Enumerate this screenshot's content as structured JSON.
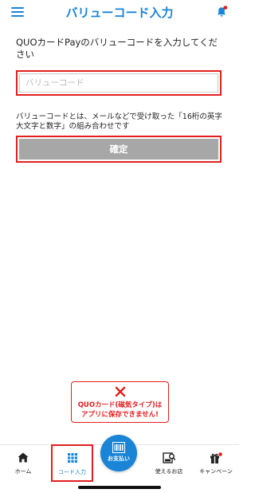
{
  "header": {
    "title": "バリューコード入力",
    "menu_icon": "hamburger-menu-icon",
    "notification_icon": "bell-icon",
    "accent_color": "#1a84d6",
    "badge_color": "#e0201d"
  },
  "main": {
    "instruction": "QUOカードPayのバリューコードを入力してください",
    "code_input": {
      "placeholder": "バリューコード",
      "value": ""
    },
    "hint": "バリューコードとは、メールなどで受け取った「16桁の英字大文字と数字」の組み合わせです",
    "confirm_label": "確定"
  },
  "warning": {
    "icon": "close-icon",
    "line1": "QUOカード(磁気タイプ)は",
    "line2": "アプリに保存できません!"
  },
  "bottom_nav": {
    "items": [
      {
        "label": "ホーム",
        "icon": "home-icon"
      },
      {
        "label": "コード入力",
        "icon": "grid-icon",
        "selected": true
      },
      {
        "label": "お支払い",
        "icon": "barcode-icon"
      },
      {
        "label": "使えるお店",
        "icon": "store-icon"
      },
      {
        "label": "キャンペーン",
        "icon": "gift-icon"
      }
    ]
  }
}
